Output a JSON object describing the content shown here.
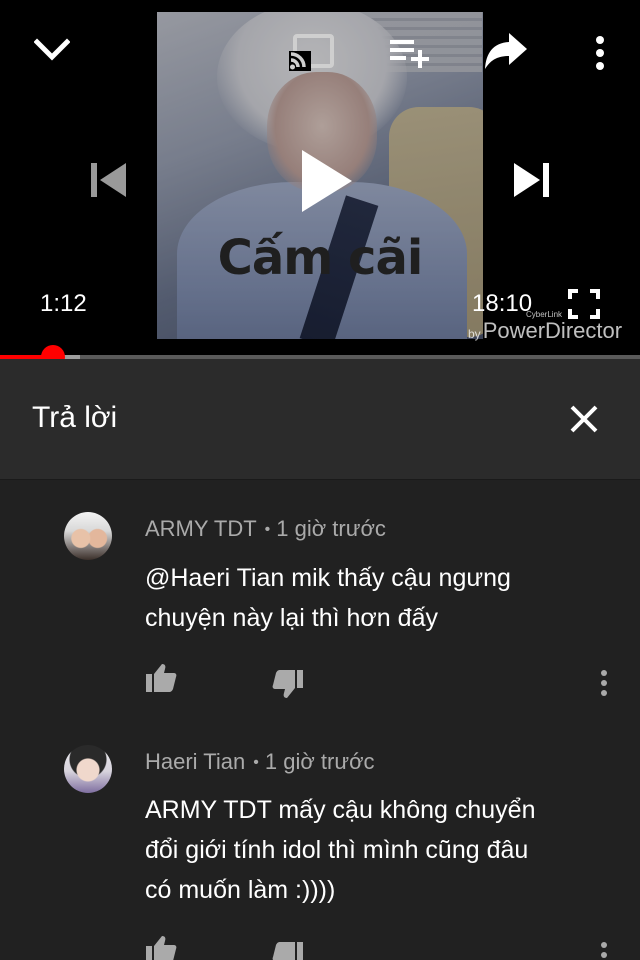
{
  "player": {
    "current_time": "1:12",
    "duration": "18:10",
    "caption": "Cấm cãi",
    "watermark_by": "by",
    "watermark_brand": "PowerDirector",
    "watermark_small": "CyberLink",
    "progress_played": 0.083,
    "progress_buffered": 0.125,
    "icons": {
      "collapse": "chevron-down-icon",
      "cast": "cast-icon",
      "add_to_queue": "add-to-queue-icon",
      "share": "share-icon",
      "more": "more-vert-icon",
      "previous": "skip-previous-icon",
      "play": "play-icon",
      "next": "skip-next-icon",
      "fullscreen": "fullscreen-icon"
    }
  },
  "reply_panel": {
    "title": "Trả lời",
    "close_icon": "close-icon"
  },
  "comments": [
    {
      "author": "ARMY TDT",
      "time": "1 giờ trước",
      "separator": "•",
      "lines": [
        "@Haeri Tian mik thấy cậu ngưng",
        "chuyện này lại thì hơn đấy"
      ]
    },
    {
      "author": "Haeri Tian",
      "time": "1 giờ trước",
      "separator": "•",
      "lines": [
        "ARMY TDT mấy cậu không chuyển",
        "đổi giới tính idol thì mình cũng đâu",
        "có muốn làm :))))"
      ]
    }
  ],
  "colors": {
    "background": "#212121",
    "header": "#2b2b2b",
    "accent": "#ff0000",
    "muted": "#aaaaaa"
  }
}
